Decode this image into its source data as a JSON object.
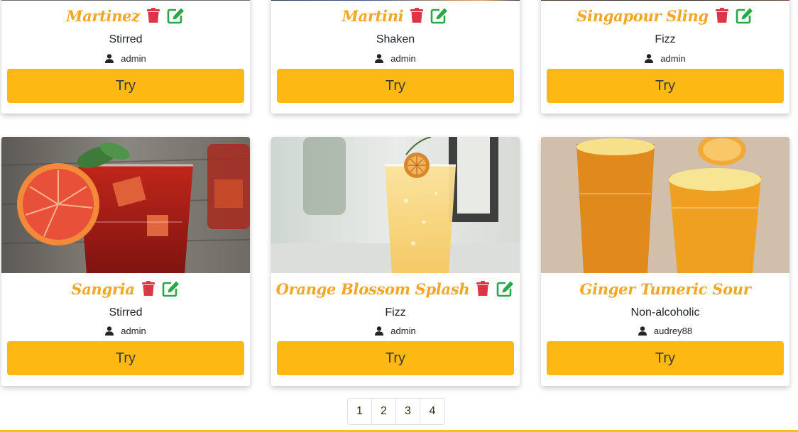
{
  "cards": [
    {
      "title": "Martinez",
      "category": "Stirred",
      "author": "admin",
      "try_label": "Try",
      "editable": true
    },
    {
      "title": "Martini",
      "category": "Shaken",
      "author": "admin",
      "try_label": "Try",
      "editable": true
    },
    {
      "title": "Singapour Sling",
      "category": "Fizz",
      "author": "admin",
      "try_label": "Try",
      "editable": true
    },
    {
      "title": "Sangria",
      "category": "Stirred",
      "author": "admin",
      "try_label": "Try",
      "editable": true
    },
    {
      "title": "Orange Blossom Splash",
      "category": "Fizz",
      "author": "admin",
      "try_label": "Try",
      "editable": true
    },
    {
      "title": "Ginger Tumeric Sour",
      "category": "Non-alcoholic",
      "author": "audrey88",
      "try_label": "Try",
      "editable": false
    }
  ],
  "pagination": {
    "pages": [
      "1",
      "2",
      "3",
      "4"
    ]
  },
  "colors": {
    "title": "#f5a623",
    "try_button": "#fdb813",
    "delete_icon": "#dc3545",
    "edit_icon": "#28a745",
    "footer_line": "#f1c40f"
  },
  "icons": {
    "delete": "trash-icon",
    "edit": "edit-icon",
    "author": "user-icon"
  }
}
